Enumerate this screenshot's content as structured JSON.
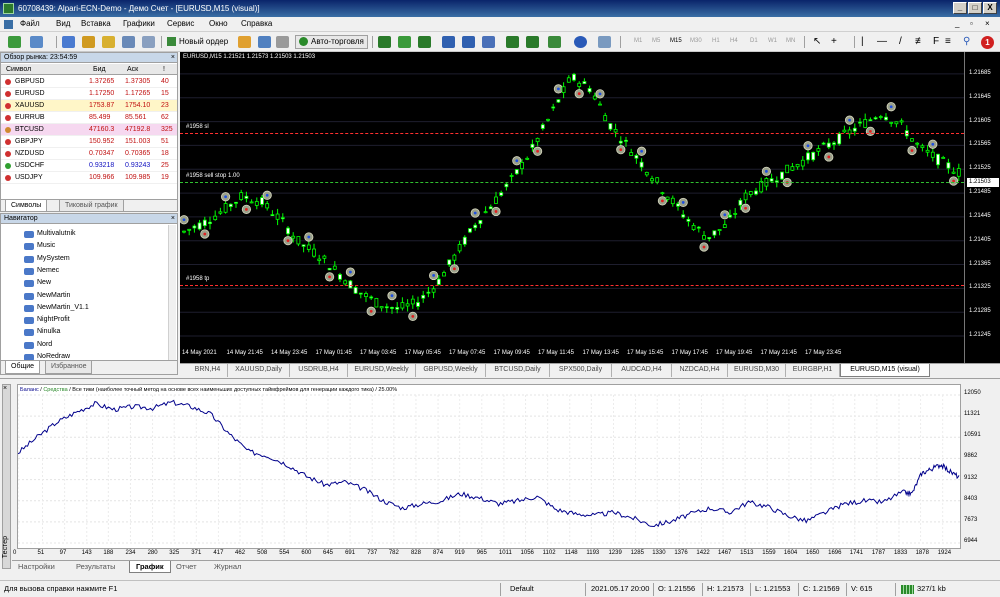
{
  "window": {
    "title": "60708439: Alpari-ECN-Demo - Демо Счет - [EURUSD,M15 (visual)]",
    "controls": [
      "_",
      "□",
      "X"
    ]
  },
  "menu": [
    "Файл",
    "Вид",
    "Вставка",
    "Графики",
    "Сервис",
    "Окно",
    "Справка"
  ],
  "toolbar": {
    "new_order": "Новый ордер",
    "auto_trading": "Авто-торговля",
    "timeframes": [
      "M1",
      "M5",
      "M15",
      "M30",
      "H1",
      "H4",
      "D1",
      "W1",
      "MN"
    ]
  },
  "market_watch": {
    "title": "Обзор рынка: 23:54:59",
    "columns": [
      "Символ",
      "Бид",
      "Аск",
      "!"
    ],
    "rows": [
      {
        "symbol": "GBPUSD",
        "bid": "1.37265",
        "ask": "1.37305",
        "spread": "40"
      },
      {
        "symbol": "EURUSD",
        "bid": "1.17250",
        "ask": "1.17265",
        "spread": "15"
      },
      {
        "symbol": "XAUUSD",
        "bid": "1753.87",
        "ask": "1754.10",
        "spread": "23"
      },
      {
        "symbol": "EURRUB",
        "bid": "85.499",
        "ask": "85.561",
        "spread": "62"
      },
      {
        "symbol": "BTCUSD",
        "bid": "47160.3",
        "ask": "47192.8",
        "spread": "325"
      },
      {
        "symbol": "GBPJPY",
        "bid": "150.952",
        "ask": "151.003",
        "spread": "51"
      },
      {
        "symbol": "NZDUSD",
        "bid": "0.70347",
        "ask": "0.70365",
        "spread": "18"
      },
      {
        "symbol": "USDCHF",
        "bid": "0.93218",
        "ask": "0.93243",
        "spread": "25"
      },
      {
        "symbol": "USDJPY",
        "bid": "109.966",
        "ask": "109.985",
        "spread": "19"
      }
    ],
    "tabs": [
      "Символы",
      "Тиковый график"
    ]
  },
  "navigator": {
    "title": "Навигатор",
    "items": [
      "Multivalutnik",
      "Music",
      "MySystem",
      "Nemec",
      "New",
      "NewMartin",
      "NewMartin_V1.1",
      "NightProfit",
      "Ninulka",
      "Nord",
      "NoRedraw"
    ],
    "tabs": [
      "Общие",
      "Избранное"
    ]
  },
  "chart": {
    "label": "EURUSD,M15  1.21521 1.21573 1.21503 1.21503",
    "current_price": "1.21503",
    "price_labels": [
      "1.21685",
      "1.21645",
      "1.21605",
      "1.21565",
      "1.21525",
      "1.21485",
      "1.21445",
      "1.21405",
      "1.21365",
      "1.21325",
      "1.21285",
      "1.21245"
    ],
    "lines": [
      {
        "label": "#1958 sl",
        "color": "#ff3030",
        "price": 1.21585
      },
      {
        "label": "#1958 sell stop 1.00",
        "color": "#30c030",
        "price": 1.21503
      },
      {
        "label": "#1958 tp",
        "color": "#ff3030",
        "price": 1.2133
      }
    ],
    "time_labels": [
      "14 May 2021",
      "14 May 21:45",
      "14 May 23:45",
      "17 May 01:45",
      "17 May 03:45",
      "17 May 05:45",
      "17 May 07:45",
      "17 May 09:45",
      "17 May 11:45",
      "17 May 13:45",
      "17 May 15:45",
      "17 May 17:45",
      "17 May 19:45",
      "17 May 21:45",
      "17 May 23:45"
    ]
  },
  "chart_tabs": [
    "BRN,H4",
    "XAUUSD,Daily",
    "USDRUB,H4",
    "EURUSD,Weekly",
    "GBPUSD,Weekly",
    "BTCUSD,Daily",
    "SPX500,Daily",
    "AUDCAD,H4",
    "NZDCAD,H4",
    "EURUSD,M30",
    "EURGBP,H1",
    "EURUSD,M15 (visual)"
  ],
  "tester": {
    "side_label": "Тестер",
    "legend": {
      "balance": "Баланс",
      "equity": "Средства",
      "rest": " / Все тики (наиболее точный метод на основе всех наименьших доступных таймфреймов для генерации каждого тика) / 25.00%"
    },
    "tabs": [
      "Настройки",
      "Результаты",
      "График",
      "Отчет",
      "Журнал"
    ]
  },
  "chart_data": {
    "type": "line",
    "title": "",
    "xlabel": "",
    "ylabel": "",
    "x_ticks": [
      "0",
      "51",
      "97",
      "143",
      "188",
      "234",
      "280",
      "325",
      "371",
      "417",
      "462",
      "508",
      "554",
      "600",
      "645",
      "691",
      "737",
      "782",
      "828",
      "874",
      "919",
      "965",
      "1011",
      "1056",
      "1102",
      "1148",
      "1193",
      "1239",
      "1285",
      "1330",
      "1376",
      "1422",
      "1467",
      "1513",
      "1559",
      "1604",
      "1650",
      "1696",
      "1741",
      "1787",
      "1833",
      "1878",
      "1924"
    ],
    "y_ticks": [
      "12050",
      "11321",
      "10591",
      "9862",
      "9132",
      "8403",
      "7673",
      "6944"
    ],
    "ylim": [
      6944,
      12050
    ],
    "xlim": [
      0,
      1960
    ],
    "grid": true,
    "series": [
      {
        "color": "#00008b",
        "x": [
          0,
          40,
          80,
          120,
          160,
          200,
          240,
          280,
          320,
          360,
          400,
          440,
          480,
          520,
          560,
          600,
          640,
          680,
          720,
          760,
          800,
          840,
          880,
          920,
          960,
          1000,
          1040,
          1080,
          1120,
          1160,
          1200,
          1240,
          1280,
          1320,
          1360,
          1400,
          1440,
          1480,
          1520,
          1560,
          1600,
          1640,
          1680,
          1720,
          1760,
          1800,
          1840,
          1860,
          1880,
          1900,
          1920,
          1940,
          1960
        ],
        "values": [
          10050,
          10600,
          11100,
          11450,
          11750,
          11550,
          11650,
          11600,
          11800,
          11650,
          11400,
          10700,
          10100,
          9950,
          9650,
          9250,
          8950,
          9050,
          8800,
          8400,
          8150,
          8300,
          8400,
          8650,
          8500,
          8300,
          8400,
          8550,
          8100,
          7950,
          7900,
          8000,
          7800,
          7550,
          7700,
          7950,
          8150,
          8000,
          8350,
          8200,
          7900,
          7700,
          8000,
          8300,
          8400,
          8350,
          8700,
          8650,
          9350,
          9500,
          9650,
          9400,
          9200
        ]
      }
    ]
  },
  "status": {
    "help": "Для вызова справки нажмите F1",
    "profile": "Default",
    "datetime": "2021.05.17 20:00",
    "open": "O: 1.21556",
    "high": "H: 1.21573",
    "low": "L: 1.21553",
    "close": "C: 1.21569",
    "volume": "V: 615",
    "traffic": "327/1 kb"
  },
  "colors": {
    "bull_candle": "#00ff00",
    "bear_candle": "#00ff00",
    "chart_bg": "#000000",
    "balance_line": "#00008b"
  }
}
